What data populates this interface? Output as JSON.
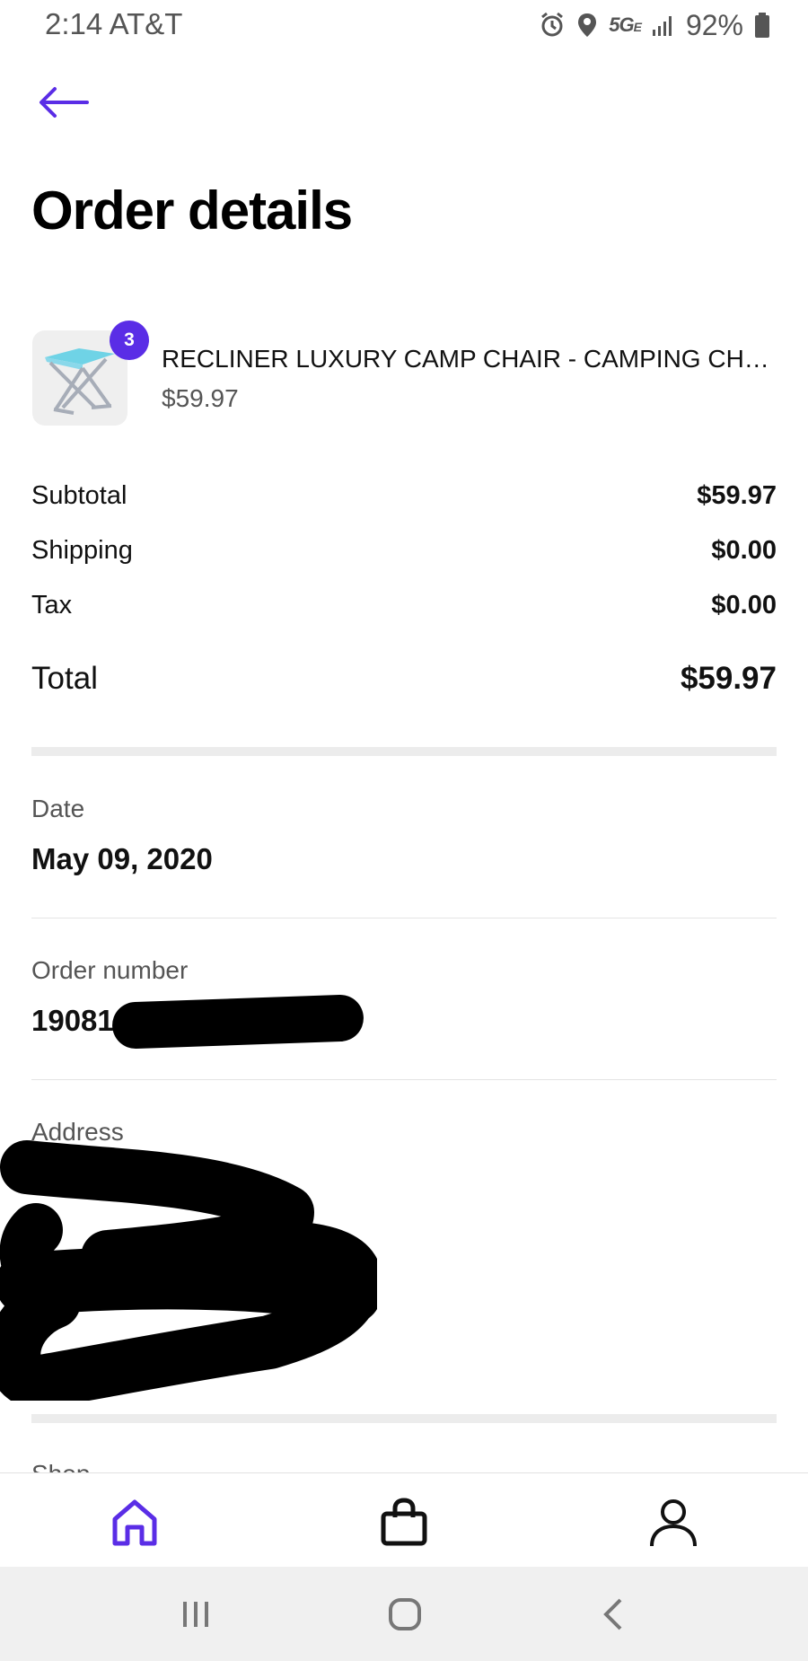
{
  "status_bar": {
    "time_carrier": "2:14 AT&T",
    "network": "5G",
    "network_sub": "E",
    "battery": "92%"
  },
  "header": {
    "title": "Order details"
  },
  "product": {
    "quantity": "3",
    "name": "RECLINER LUXURY CAMP CHAIR - CAMPING CHAIR",
    "price": "$59.97"
  },
  "summary": {
    "subtotal_label": "Subtotal",
    "subtotal_value": "$59.97",
    "shipping_label": "Shipping",
    "shipping_value": "$0.00",
    "tax_label": "Tax",
    "tax_value": "$0.00",
    "total_label": "Total",
    "total_value": "$59.97"
  },
  "details": {
    "date_label": "Date",
    "date_value": "May 09, 2020",
    "order_label": "Order number",
    "order_value_visible": "19081",
    "address_label": "Address"
  },
  "next_section": {
    "label_partial": "Shop"
  },
  "colors": {
    "accent": "#5a2de6",
    "text": "#111111",
    "muted": "#555555"
  },
  "bottom_nav": {
    "items": [
      "home-icon",
      "shopping-bag-icon",
      "profile-icon"
    ],
    "active": "home-icon"
  },
  "system_nav": {
    "items": [
      "recent-apps-icon",
      "home-circle-icon",
      "system-back-icon"
    ]
  }
}
